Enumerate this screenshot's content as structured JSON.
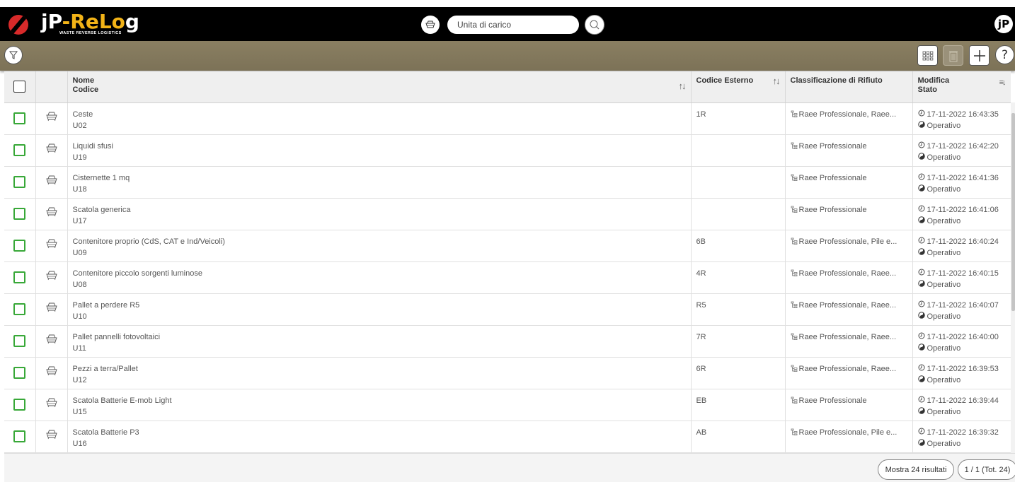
{
  "app": {
    "name_part1": "jP",
    "name_part2": "-ReL",
    "name_part3": "o",
    "name_part4": "g",
    "subtitle": "WASTE REVERSE LOGISTICS",
    "user_initials": "jP"
  },
  "search": {
    "placeholder": "Unita di carico",
    "value": ""
  },
  "colors": {
    "topbar": "#000000",
    "toolbar": "#8a7f62",
    "checkbox": "#38a838",
    "logo_red": "#d82a2a",
    "logo_accent": "#f2b317"
  },
  "toolbar": {
    "filter_icon": "filter-icon",
    "grid_icon": "grid-view-icon",
    "delete_icon": "trash-icon",
    "add_icon": "plus-icon",
    "help_icon": "question-icon"
  },
  "table": {
    "headers": {
      "nome": "Nome",
      "codice": "Codice",
      "codice_esterno": "Codice Esterno",
      "classificazione": "Classificazione di Rifiuto",
      "modifica": "Modifica",
      "stato": "Stato"
    },
    "rows": [
      {
        "nome": "Ceste",
        "codice": "U02",
        "esterno": "1R",
        "classificazione": "Raee Professionale, Raee...",
        "data": "17-11-2022 16:43:35",
        "stato": "Operativo"
      },
      {
        "nome": "Liquidi sfusi",
        "codice": "U19",
        "esterno": "",
        "classificazione": "Raee Professionale",
        "data": "17-11-2022 16:42:20",
        "stato": "Operativo"
      },
      {
        "nome": "Cisternette 1 mq",
        "codice": "U18",
        "esterno": "",
        "classificazione": "Raee Professionale",
        "data": "17-11-2022 16:41:36",
        "stato": "Operativo"
      },
      {
        "nome": "Scatola generica",
        "codice": "U17",
        "esterno": "",
        "classificazione": "Raee Professionale",
        "data": "17-11-2022 16:41:06",
        "stato": "Operativo"
      },
      {
        "nome": "Contenitore proprio (CdS, CAT e Ind/Veicoli)",
        "codice": "U09",
        "esterno": "6B",
        "classificazione": "Raee Professionale, Pile e...",
        "data": "17-11-2022 16:40:24",
        "stato": "Operativo"
      },
      {
        "nome": "Contenitore piccolo sorgenti luminose",
        "codice": "U08",
        "esterno": "4R",
        "classificazione": "Raee Professionale, Raee...",
        "data": "17-11-2022 16:40:15",
        "stato": "Operativo"
      },
      {
        "nome": "Pallet a perdere R5",
        "codice": "U10",
        "esterno": "R5",
        "classificazione": "Raee Professionale, Raee...",
        "data": "17-11-2022 16:40:07",
        "stato": "Operativo"
      },
      {
        "nome": "Pallet pannelli fotovoltaici",
        "codice": "U11",
        "esterno": "7R",
        "classificazione": "Raee Professionale, Raee...",
        "data": "17-11-2022 16:40:00",
        "stato": "Operativo"
      },
      {
        "nome": "Pezzi a terra/Pallet",
        "codice": "U12",
        "esterno": "6R",
        "classificazione": "Raee Professionale, Raee...",
        "data": "17-11-2022 16:39:53",
        "stato": "Operativo"
      },
      {
        "nome": "Scatola Batterie E-mob Light",
        "codice": "U15",
        "esterno": "EB",
        "classificazione": "Raee Professionale",
        "data": "17-11-2022 16:39:44",
        "stato": "Operativo"
      },
      {
        "nome": "Scatola Batterie P3",
        "codice": "U16",
        "esterno": "AB",
        "classificazione": "Raee Professionale, Pile e...",
        "data": "17-11-2022 16:39:32",
        "stato": "Operativo"
      }
    ]
  },
  "footer": {
    "show_results": "Mostra 24 risultati",
    "pagination": "1 / 1 (Tot. 24)"
  }
}
